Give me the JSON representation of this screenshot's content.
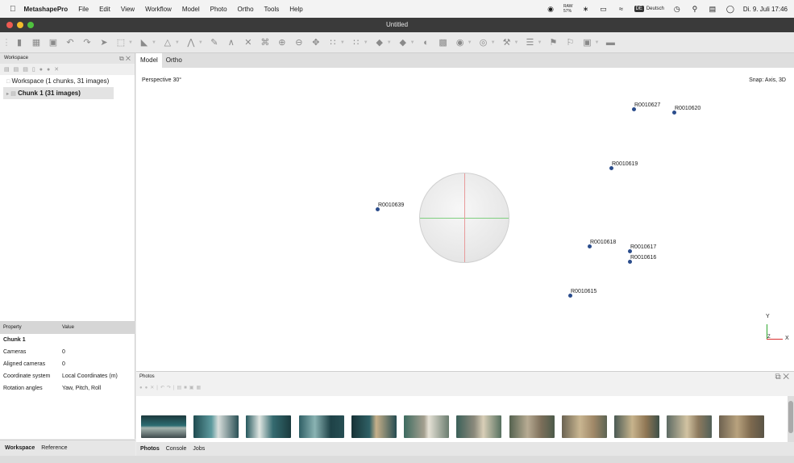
{
  "menubar": {
    "app_name": "MetashapePro",
    "items": [
      "File",
      "Edit",
      "View",
      "Workflow",
      "Model",
      "Photo",
      "Ortho",
      "Tools",
      "Help"
    ],
    "status_icons": [
      "camera-icon",
      "battery-icon",
      "bluetooth-icon",
      "display-icon",
      "wifi-icon"
    ],
    "battery_pct": "57%",
    "battery_label": "RAW",
    "lang_badge": "DE",
    "lang": "Deutsch",
    "clock": "Di. 9. Juli 17:46"
  },
  "window": {
    "title": "Untitled"
  },
  "toolbar": {
    "icons": [
      "new-icon",
      "open-icon",
      "save-icon",
      "undo-icon",
      "redo-icon",
      "navigate-icon",
      "rect-select-icon",
      "shape-icon",
      "ruler-icon",
      "draw-line-icon",
      "draw-polygon-icon",
      "polyline-icon",
      "delete-icon",
      "crop-icon",
      "zoom-in-icon",
      "zoom-out-icon",
      "move-object-icon",
      "point-cloud-icon",
      "dense-cloud-icon",
      "mesh-icon",
      "texture-icon",
      "tiled-icon",
      "dem-icon",
      "orthomosaic-icon",
      "globe-icon",
      "camera-view-icon",
      "marker-icon",
      "list-icon",
      "flag-icon",
      "flag-outline-icon",
      "image-view-icon",
      "region-icon"
    ]
  },
  "workspace": {
    "title": "Workspace",
    "root_label": "Workspace (1 chunks, 31 images)",
    "chunk_label": "Chunk 1 (31 images)"
  },
  "properties": {
    "header": [
      "Property",
      "Value"
    ],
    "section": "Chunk 1",
    "rows": [
      {
        "name": "Cameras",
        "value": "0"
      },
      {
        "name": "Aligned cameras",
        "value": "0"
      },
      {
        "name": "Coordinate system",
        "value": "Local Coordinates (m)"
      },
      {
        "name": "Rotation angles",
        "value": "Yaw, Pitch, Roll"
      }
    ]
  },
  "left_tabs": [
    "Workspace",
    "Reference"
  ],
  "view": {
    "tabs": [
      "Model",
      "Ortho"
    ],
    "perspective": "Perspective 30°",
    "snap": "Snap: Axis, 3D",
    "cameras": [
      "R0010627",
      "R0010620",
      "R0010619",
      "R0010639",
      "R0010618",
      "R0010617",
      "R0010616",
      "R0010615"
    ],
    "axes": {
      "y": "Y",
      "z": "Z",
      "x": "X"
    }
  },
  "photos": {
    "title": "Photos",
    "thumb_count": 12
  },
  "bottom_tabs": [
    "Photos",
    "Console",
    "Jobs"
  ],
  "colors": {
    "camera_dot": "#2b4d8c",
    "titlebar": "#3a3a3a",
    "axis_y": "#2ea82e",
    "axis_x": "#d93030"
  }
}
